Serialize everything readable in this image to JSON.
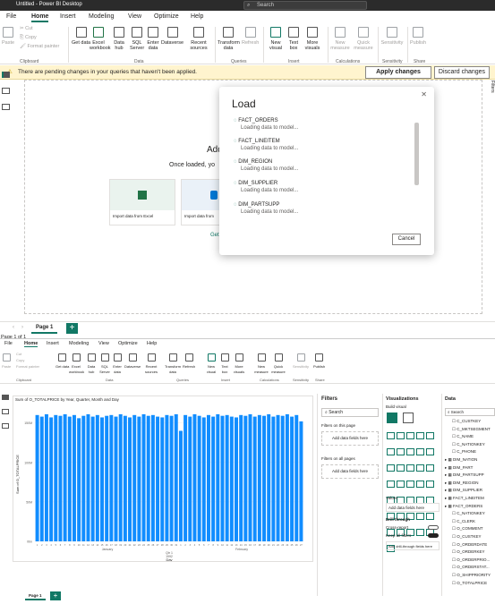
{
  "top": {
    "title": "Untitled - Power BI Desktop",
    "search": "Search",
    "menu": [
      "File",
      "Home",
      "Insert",
      "Modeling",
      "View",
      "Optimize",
      "Help"
    ],
    "ribbon": {
      "paste": "Paste",
      "cut": "Cut",
      "copy": "Copy",
      "format_painter": "Format painter",
      "get_data": "Get data",
      "excel": "Excel workbook",
      "data_hub": "Data hub",
      "sql": "SQL Server",
      "enter_data": "Enter data",
      "dataverse": "Dataverse",
      "recent": "Recent sources",
      "transform": "Transform data",
      "refresh": "Refresh",
      "new_visual": "New visual",
      "text_box": "Text box",
      "more_visuals": "More visuals",
      "new_measure": "New measure",
      "quick_measure": "Quick measure",
      "sensitivity": "Sensitivity",
      "publish": "Publish"
    },
    "groups": {
      "clipboard": "Clipboard",
      "data": "Data",
      "queries": "Queries",
      "insert": "Insert",
      "calculations": "Calculations",
      "sensitivity": "Sensitivity",
      "share": "Share"
    },
    "banner": {
      "text": "There are pending changes in your queries that haven't been applied.",
      "apply": "Apply changes",
      "discard": "Discard changes"
    },
    "canvas": {
      "heading": "Add",
      "sub": "Once loaded, yo",
      "get": "Get",
      "excel_card": "Import data from Excel",
      "sql_card": "Import data from"
    },
    "dialog": {
      "title": "Load",
      "items": [
        {
          "name": "FACT_ORDERS",
          "status": "Loading data to model..."
        },
        {
          "name": "FACT_LINEITEM",
          "status": "Loading data to model..."
        },
        {
          "name": "DIM_REGION",
          "status": "Loading data to model..."
        },
        {
          "name": "DIM_SUPPLIER",
          "status": "Loading data to model..."
        },
        {
          "name": "DIM_PARTSUPP",
          "status": "Loading data to model..."
        }
      ],
      "cancel": "Cancel"
    },
    "page_tab": "Page 1",
    "page_status": "Page 1 of 1",
    "filters_side": "Filters"
  },
  "bottom": {
    "menu": [
      "File",
      "Home",
      "Insert",
      "Modeling",
      "View",
      "Optimize",
      "Help"
    ],
    "ribbon": {
      "paste": "Paste",
      "cut": "Cut",
      "copy": "Copy",
      "format_painter": "Format painter",
      "get_data": "Get data",
      "excel": "Excel workbook",
      "data_hub": "Data hub",
      "sql": "SQL Server",
      "enter_data": "Enter data",
      "dataverse": "Dataverse",
      "recent": "Recent sources",
      "transform": "Transform data",
      "refresh": "Refresh",
      "new_visual": "New visual",
      "text_box": "Text box",
      "more_visuals": "More visuals",
      "new_measure": "New measure",
      "quick_measure": "Quick measure",
      "sensitivity": "Sensitivity",
      "publish": "Publish"
    },
    "groups": {
      "clipboard": "Clipboard",
      "data": "Data",
      "queries": "Queries",
      "insert": "Insert",
      "calculations": "Calculations",
      "sensitivity": "Sensitivity",
      "share": "Share"
    },
    "page_tab": "Page 1",
    "filters": {
      "title": "Filters",
      "search": "Search",
      "on_page": "Filters on this page",
      "on_all": "Filters on all pages",
      "add": "Add data fields here"
    },
    "viz": {
      "title": "Visualizations",
      "build": "Build visual",
      "values": "Values",
      "add_values": "Add data fields here",
      "drill": "Drill through",
      "cross": "Cross-report",
      "keep": "Keep all filters",
      "add_drill": "Add drill-through fields here"
    },
    "data": {
      "title": "Data",
      "search": "Search",
      "fields": [
        "C_CUSTKEY",
        "C_MKTSEGMENT",
        "C_NAME",
        "C_NATIONKEY",
        "C_PHONE",
        "DIM_NATION",
        "DIM_PART",
        "DIM_PARTSUPP",
        "DIM_REGION",
        "DIM_SUPPLIER",
        "FACT_LINEITEM",
        "FACT_ORDERS",
        "C_NATIONKEY",
        "C_CLERK",
        "O_COMMENT",
        "O_CUSTKEY",
        "O_ORDERDATE",
        "O_ORDERKEY",
        "O_ORDERPRIO...",
        "O_ORDERSTAT...",
        "O_SHIPPRIORITY",
        "O_TOTALPRICE"
      ]
    }
  },
  "chart_data": {
    "type": "bar",
    "title": "Sum of O_TOTALPRICE by Year, Quarter, Month and Day",
    "ylabel": "Sum of O_TOTALPRICE",
    "xlabel": "Day",
    "yticks": [
      "0bn",
      "50M",
      "100M",
      "150M"
    ],
    "x_groups": [
      "January",
      "February"
    ],
    "x_meta": [
      "Qtr 1",
      "1992"
    ],
    "ylim": [
      0,
      170
    ],
    "values": [
      160,
      158,
      161,
      157,
      160,
      159,
      161,
      158,
      160,
      156,
      159,
      161,
      158,
      160,
      157,
      159,
      160,
      158,
      161,
      159,
      157,
      160,
      158,
      161,
      159,
      160,
      158,
      157,
      160,
      159,
      161,
      140,
      160,
      158,
      161,
      159,
      157,
      160,
      158,
      161,
      159,
      160,
      158,
      157,
      160,
      159,
      161,
      158,
      160,
      159,
      161,
      158,
      160,
      159,
      161,
      158,
      160,
      152
    ],
    "color": "#118dff"
  }
}
